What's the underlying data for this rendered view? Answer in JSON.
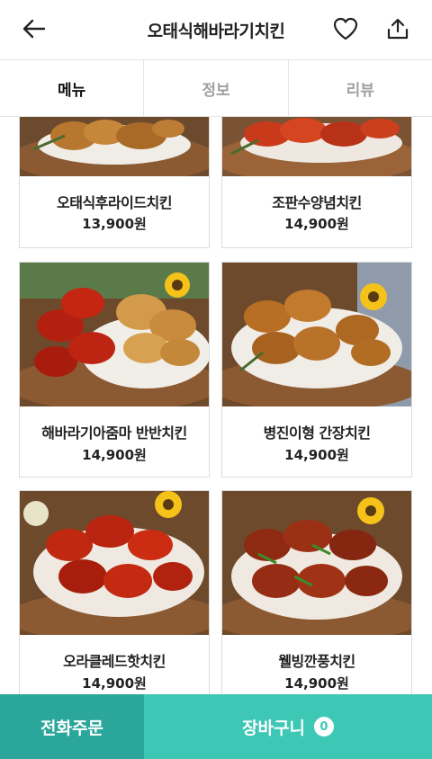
{
  "header": {
    "title": "오태식해바라기치킨",
    "back_icon": "arrow-left-icon",
    "favorite_icon": "heart-icon",
    "share_icon": "share-icon"
  },
  "tabs": [
    {
      "label": "메뉴",
      "active": true
    },
    {
      "label": "정보",
      "active": false
    },
    {
      "label": "리뷰",
      "active": false
    }
  ],
  "menu_items": [
    {
      "name": "오태식후라이드치킨",
      "price": "13,900원",
      "sauce": "fried"
    },
    {
      "name": "조판수양념치킨",
      "price": "14,900원",
      "sauce": "red"
    },
    {
      "name": "해바라기아줌마 반반치킨",
      "price": "14,900원",
      "sauce": "half"
    },
    {
      "name": "병진이형 간장치킨",
      "price": "14,900원",
      "sauce": "soy"
    },
    {
      "name": "오라클레드핫치킨",
      "price": "14,900원",
      "sauce": "hot"
    },
    {
      "name": "웰빙깐풍치킨",
      "price": "14,900원",
      "sauce": "kkanpung"
    }
  ],
  "bottom_bar": {
    "call_label": "전화주문",
    "cart_label": "장바구니",
    "cart_count": "0"
  },
  "colors": {
    "call_bg": "#2aa79a",
    "cart_bg": "#3cc8b4"
  }
}
